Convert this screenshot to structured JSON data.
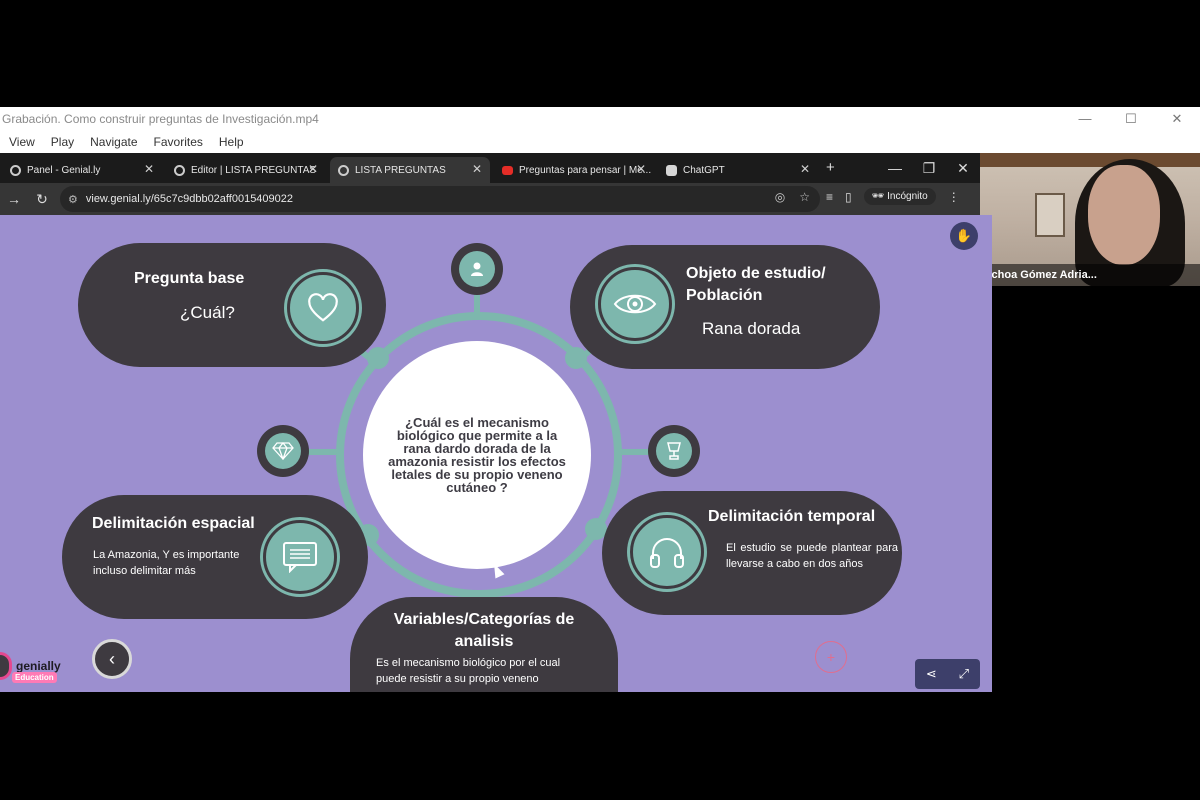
{
  "player": {
    "title": "Grabación. Como construir preguntas de Investigación.mp4",
    "menu": [
      "View",
      "Play",
      "Navigate",
      "Favorites",
      "Help"
    ]
  },
  "browser": {
    "tabs": [
      {
        "label": "Panel - Genial.ly",
        "icon": "genially-icon"
      },
      {
        "label": "Editor | LISTA PREGUNTAS",
        "icon": "genially-icon"
      },
      {
        "label": "LISTA PREGUNTAS",
        "icon": "genially-icon",
        "active": true
      },
      {
        "label": "Preguntas para pensar | Me...",
        "icon": "youtube-icon"
      },
      {
        "label": "ChatGPT",
        "icon": "chatgpt-icon"
      }
    ],
    "url": "view.genial.ly/65c7c9dbb02aff0015409022",
    "incognito_label": "Incógnito"
  },
  "webcam": {
    "participant_name": "Ochoa Gómez Adria..."
  },
  "slide": {
    "center_question": "¿Cuál es el mecanismo biológico que permite a la rana dardo dorada de la amazonia resistir los efectos letales de su propio veneno cutáneo ?",
    "pregunta_base": {
      "title": "Pregunta base",
      "text": "¿Cuál?"
    },
    "objeto": {
      "title": "Objeto de estudio/ Población",
      "text": "Rana dorada"
    },
    "delim_espacial": {
      "title": "Delimitación espacial",
      "text": "La Amazonia, Y es importante incluso delimitar más"
    },
    "delim_temporal": {
      "title": "Delimitación temporal",
      "text": "El estudio se puede plantear para llevarse a cabo en dos años"
    },
    "variables": {
      "title": "Variables/Categorías de analisis",
      "text": "Es el mecanismo biológico  por el cual puede resistir a su propio veneno"
    },
    "logo_text": "genially",
    "logo_badge": "Education",
    "colors": {
      "background": "#9c8fcf",
      "teal": "#7db7ad",
      "dark": "#3e3a40"
    }
  }
}
